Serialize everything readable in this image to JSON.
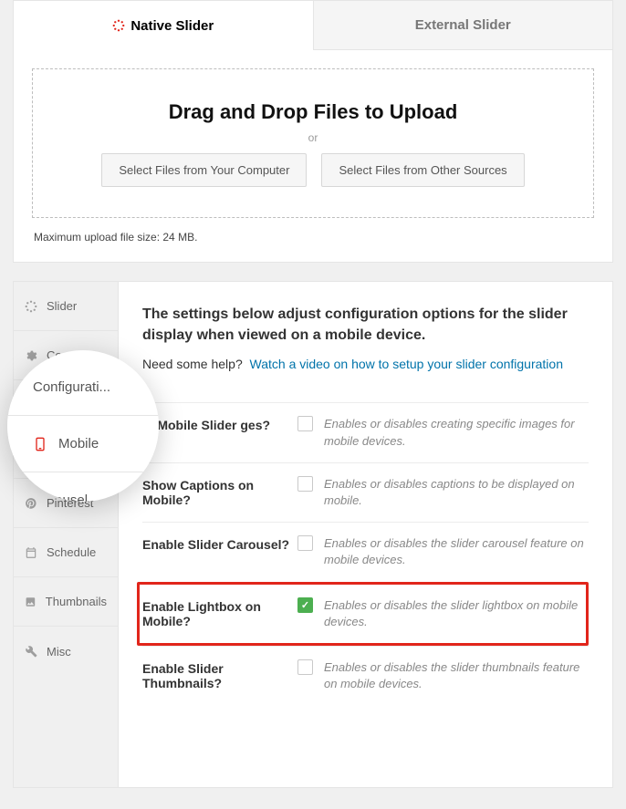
{
  "tabs": {
    "native": "Native Slider",
    "external": "External Slider"
  },
  "dropzone": {
    "title": "Drag and Drop Files to Upload",
    "or": "or",
    "btn_computer": "Select Files from Your Computer",
    "btn_other": "Select Files from Other Sources"
  },
  "max_size": "Maximum upload file size: 24 MB.",
  "sidebar": {
    "items": [
      "Slider",
      "Co",
      "",
      "",
      "Pinterest",
      "Schedule",
      "Thumbnails",
      "Misc"
    ]
  },
  "magnifier": {
    "configuration": "Configurati...",
    "mobile": "Mobile",
    "carousel": "Carousel"
  },
  "content": {
    "heading": "The settings below adjust configuration options for the slider display when viewed on a mobile device.",
    "help_text": "Need some help?",
    "help_link": "Watch a video on how to setup your slider configuration"
  },
  "settings": [
    {
      "label": "te Mobile Slider ges?",
      "checked": false,
      "desc": "Enables or disables creating specific images for mobile devices."
    },
    {
      "label": "Show Captions on Mobile?",
      "checked": false,
      "desc": "Enables or disables captions to be displayed on mobile."
    },
    {
      "label": "Enable Slider Carousel?",
      "checked": false,
      "desc": "Enables or disables the slider carousel feature on mobile devices."
    },
    {
      "label": "Enable Lightbox on Mobile?",
      "checked": true,
      "desc": "Enables or disables the slider lightbox on mobile devices."
    },
    {
      "label": "Enable Slider Thumbnails?",
      "checked": false,
      "desc": "Enables or disables the slider thumbnails feature on mobile devices."
    }
  ]
}
